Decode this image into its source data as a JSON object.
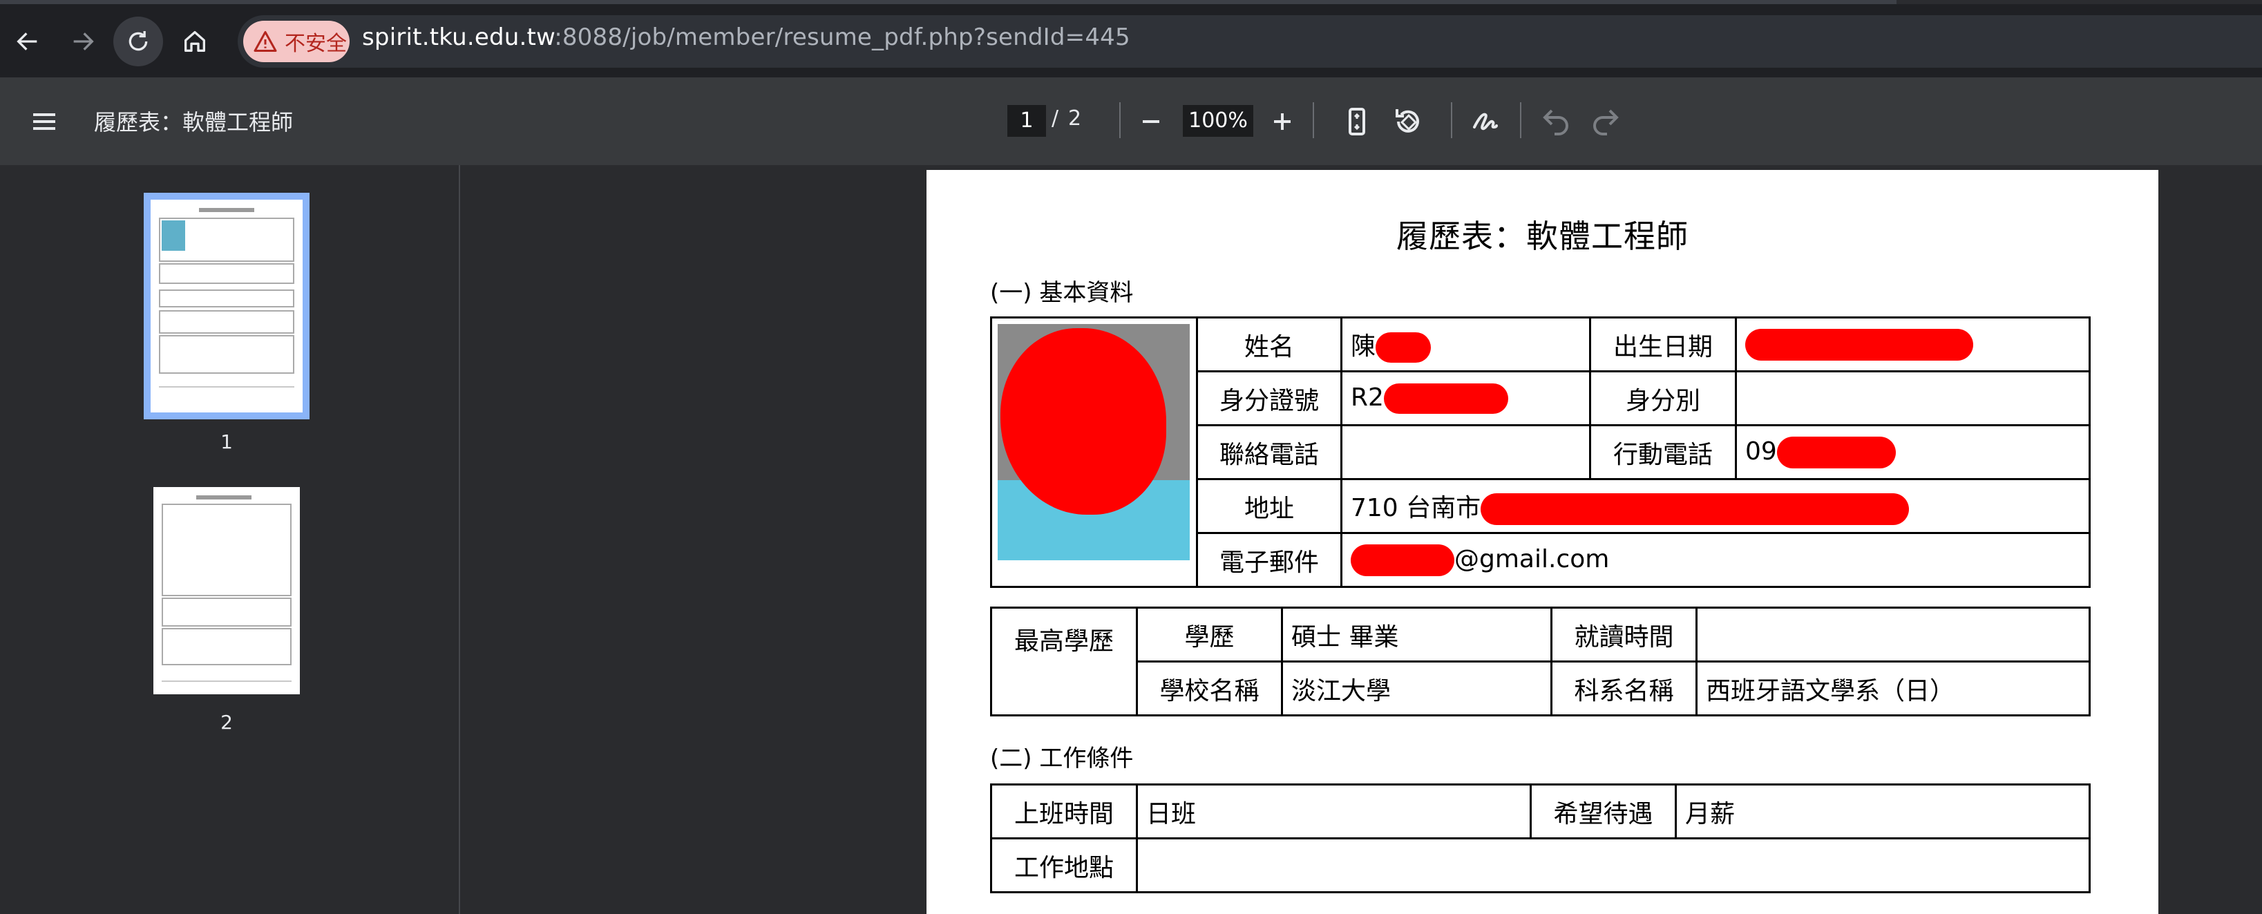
{
  "browser": {
    "security_label": "不安全",
    "url_host": "spirit.tku.edu.tw",
    "url_rest": ":8088/job/member/resume_pdf.php?sendId=445"
  },
  "toolbar": {
    "title": "履歷表：軟體工程師",
    "current_page": "1",
    "page_separator": "/",
    "total_pages": "2",
    "zoom": "100%"
  },
  "sidebar": {
    "thumbnails": [
      {
        "label": "1",
        "selected": true
      },
      {
        "label": "2",
        "selected": false
      }
    ]
  },
  "document": {
    "heading": "履歷表：軟體工程師",
    "section1": "(一) 基本資料",
    "basic": {
      "name_label": "姓名",
      "name_value": "陳",
      "dob_label": "出生日期",
      "id_label": "身分證號",
      "id_value": "R2",
      "gender_label": "身分別",
      "phone_label": "聯絡電話",
      "mobile_label": "行動電話",
      "mobile_value": "09",
      "address_label": "地址",
      "address_value": "710 台南市",
      "email_label": "電子郵件",
      "email_value": "@gmail.com"
    },
    "education": {
      "group_label": "最高學歷",
      "degree_label": "學歷",
      "degree_value": "碩士 畢業",
      "period_label": "就讀時間",
      "school_label": "學校名稱",
      "school_value": "淡江大學",
      "dept_label": "科系名稱",
      "dept_value": "西班牙語文學系（日）"
    },
    "section2": "(二) 工作條件",
    "work": {
      "shift_label": "上班時間",
      "shift_value": "日班",
      "salary_label": "希望待遇",
      "salary_value": "月薪",
      "location_label": "工作地點"
    }
  },
  "colors": {
    "redaction": "#ff0000",
    "thumb_selected_border": "#8ab4f8",
    "security_chip_bg": "#f5c6c6",
    "security_chip_text": "#b3261e"
  }
}
